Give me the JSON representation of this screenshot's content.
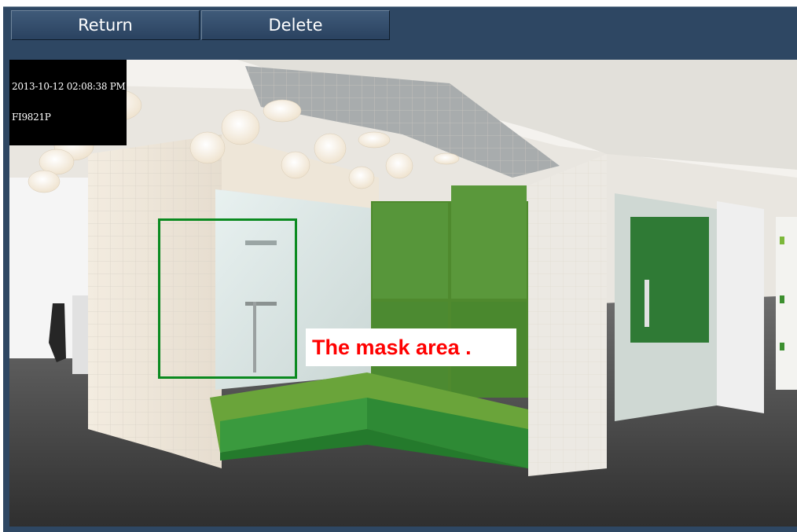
{
  "toolbar": {
    "return_label": "Return",
    "delete_label": "Delete"
  },
  "video": {
    "osd_timestamp": "2013-10-12 02:08:38 PM",
    "osd_camera": "FI9821P",
    "mask_label": "The mask area ."
  },
  "colors": {
    "frame": "#2e4763",
    "mask_border": "#0b8a20",
    "mask_text": "#ff0000"
  }
}
